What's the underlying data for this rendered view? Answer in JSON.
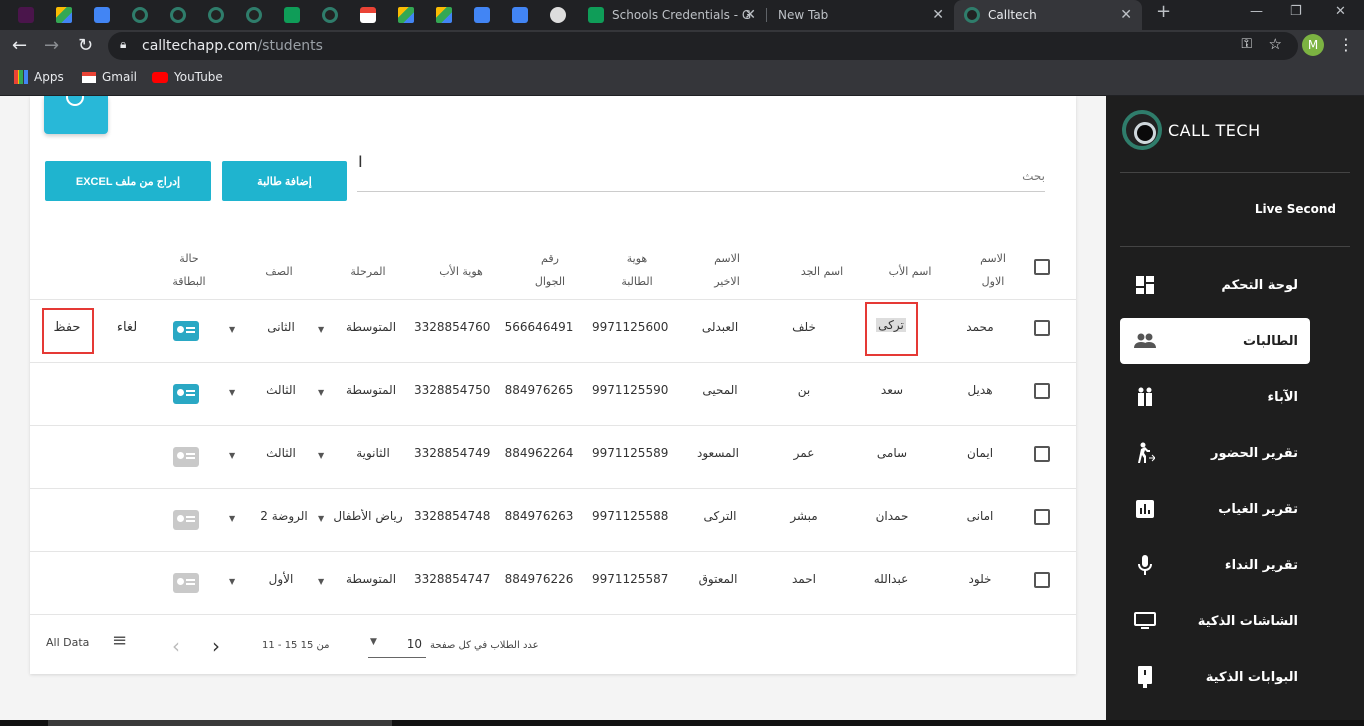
{
  "browser": {
    "tabs": [
      {
        "title": "Schools Credentials - Go"
      },
      {
        "title": "New Tab"
      },
      {
        "title": "Calltech"
      }
    ],
    "url_host": "calltechapp.com",
    "url_path": "/students",
    "profile_initial": "M",
    "bookmarks": [
      {
        "label": "Apps"
      },
      {
        "label": "Gmail"
      },
      {
        "label": "YouTube"
      }
    ]
  },
  "sidebar": {
    "brand": "CALL TECH",
    "live_label": "Live Second",
    "items": [
      {
        "label": "لوحة التحكم",
        "icon": "dashboard-icon"
      },
      {
        "label": "الطالبات",
        "icon": "people-icon"
      },
      {
        "label": "الآباء",
        "icon": "family-icon"
      },
      {
        "label": "تقرير الحضور",
        "icon": "walk-icon"
      },
      {
        "label": "تقرير الغياب",
        "icon": "bar-chart-icon"
      },
      {
        "label": "تقرير النداء",
        "icon": "mic-icon"
      },
      {
        "label": "الشاشات الذكية",
        "icon": "monitor-icon"
      },
      {
        "label": "البوابات الذكية",
        "icon": "gate-icon"
      }
    ]
  },
  "toolbar": {
    "import_label": "EXCEL إدراج من ملف",
    "add_label": "إضافة طالبة",
    "search_placeholder": "بحث"
  },
  "table": {
    "headers": {
      "first_name": "الاسم الاول",
      "father_name": "اسم الأب",
      "grandfather_name": "اسم الجد",
      "last_name": "الاسم الاخير",
      "student_id": "هوية الطالبة",
      "mobile": "رقم الجوال",
      "father_id": "هوية الأب",
      "stage": "المرحلة",
      "grade": "الصف",
      "card_status": "حالة البطاقة"
    },
    "rows": [
      {
        "first": "محمد",
        "father": "تركى",
        "grand": "خلف",
        "last": "العبدلى",
        "sid": "9971125600",
        "mobile": "566646491",
        "fid": "3328854760",
        "stage": "المتوسطة",
        "grade": "الثانى",
        "card_active": true
      },
      {
        "first": "هديل",
        "father": "سعد",
        "grand": "بن",
        "last": "المحيى",
        "sid": "9971125590",
        "mobile": "884976265",
        "fid": "3328854750",
        "stage": "المتوسطة",
        "grade": "الثالث",
        "card_active": true
      },
      {
        "first": "ايمان",
        "father": "سامى",
        "grand": "عمر",
        "last": "المسعود",
        "sid": "9971125589",
        "mobile": "884962264",
        "fid": "3328854749",
        "stage": "الثانوية",
        "grade": "الثالث",
        "card_active": false
      },
      {
        "first": "امانى",
        "father": "حمدان",
        "grand": "مبشر",
        "last": "التركى",
        "sid": "9971125588",
        "mobile": "884976263",
        "fid": "3328854748",
        "stage": "رياض الأطفال",
        "grade": "الروضة 2",
        "card_active": false
      },
      {
        "first": "خلود",
        "father": "عبدالله",
        "grand": "احمد",
        "last": "المعتوق",
        "sid": "9971125587",
        "mobile": "884976226",
        "fid": "3328854747",
        "stage": "المتوسطة",
        "grade": "الأول",
        "card_active": false
      }
    ],
    "row_actions": {
      "save": "حفظ",
      "cancel": "لغاء"
    }
  },
  "footer": {
    "all_data": "All Data",
    "range": "11 - 15 من 15",
    "per_page_value": "10",
    "per_page_label": "عدد الطلاب في كل صفحة"
  },
  "colors": {
    "accent": "#1fb4cf",
    "card_active": "#2aa8c4",
    "card_inactive": "#c9c9c9",
    "highlight": "#e53935"
  }
}
